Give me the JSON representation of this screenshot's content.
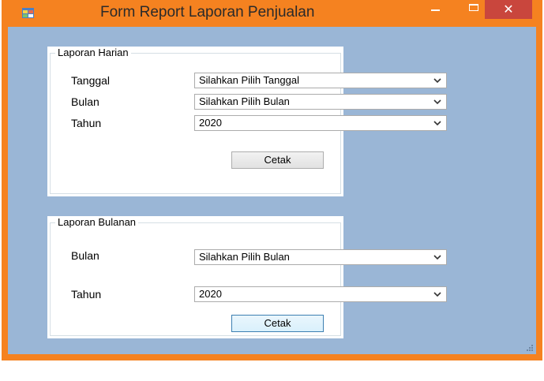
{
  "window": {
    "title": "Form Report Laporan Penjualan",
    "icons": {
      "app": "form-app-icon",
      "minimize": "minimize-icon",
      "maximize": "maximize-icon",
      "close": "close-icon"
    },
    "close_glyph": "✕",
    "colors": {
      "frame": "#f58220",
      "client": "#9ab6d6",
      "close": "#c9463d"
    }
  },
  "daily": {
    "legend": "Laporan Harian",
    "tanggal_label": "Tanggal",
    "tanggal_value": "Silahkan Pilih Tanggal",
    "bulan_label": "Bulan",
    "bulan_value": "Silahkan Pilih Bulan",
    "tahun_label": "Tahun",
    "tahun_value": "2020",
    "print_label": "Cetak"
  },
  "monthly": {
    "legend": "Laporan Bulanan",
    "bulan_label": "Bulan",
    "bulan_value": "Silahkan Pilih Bulan",
    "tahun_label": "Tahun",
    "tahun_value": "2020",
    "print_label": "Cetak"
  }
}
